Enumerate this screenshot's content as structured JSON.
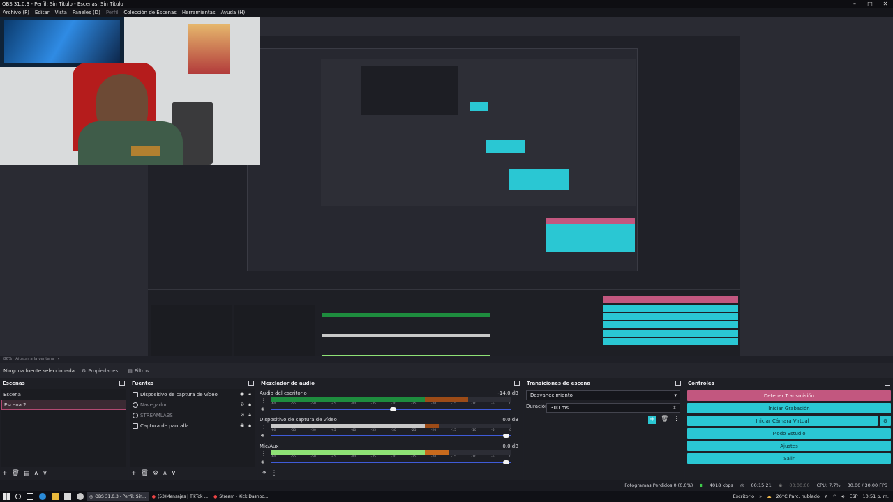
{
  "window": {
    "title": "OBS 31.0.3 - Perfil: Sin Título - Escenas: Sin Título"
  },
  "menu": [
    "Archivo (F)",
    "Editar",
    "Vista",
    "Paneles (D)",
    "Perfil",
    "Colección de Escenas",
    "Herramientas",
    "Ayuda (H)"
  ],
  "scale": {
    "percent": "86%",
    "mode": "Ajustar a la ventana"
  },
  "context_bar": {
    "no_source": "Ninguna fuente seleccionada",
    "properties": "Propiedades",
    "filters": "Filtros"
  },
  "scenes": {
    "title": "Escenas",
    "items": [
      "Escena",
      "Escena 2"
    ],
    "selected": "Escena 2"
  },
  "sources": {
    "title": "Fuentes",
    "items": [
      {
        "name": "Dispositivo de captura de vídeo",
        "visible": true
      },
      {
        "name": "Navegador",
        "visible": false
      },
      {
        "name": "STREAMLABS",
        "visible": false
      },
      {
        "name": "Captura de pantalla",
        "visible": true
      }
    ]
  },
  "mixer": {
    "title": "Mezclador de audio",
    "ticks": [
      "-60",
      "-55",
      "-50",
      "-45",
      "-40",
      "-35",
      "-30",
      "-25",
      "-20",
      "-15",
      "-10",
      "-5",
      "0"
    ],
    "channels": [
      {
        "name": "Audio del escritorio",
        "db": "-14.0 dB",
        "level": 0.82,
        "volume": 0.51,
        "style": "normal"
      },
      {
        "name": "Dispositivo de captura de vídeo",
        "db": "0.0 dB",
        "level": 0.7,
        "volume": 0.98,
        "style": "grey"
      },
      {
        "name": "Mic/Aux",
        "db": "0.0 dB",
        "level": 0.74,
        "volume": 0.98,
        "style": "bright"
      }
    ]
  },
  "transitions": {
    "title": "Transiciones de escena",
    "selected": "Desvanecimiento",
    "duration_label": "Duración",
    "duration": "300 ms"
  },
  "controls": {
    "title": "Controles",
    "buttons": [
      "Detener Transmisión",
      "Iniciar Grabación",
      "Iniciar Cámara Virtual",
      "Modo Estudio",
      "Ajustes",
      "Salir"
    ]
  },
  "status": {
    "dropped": "Fotogramas Perdidos 0 (0.0%)",
    "bitrate": "4018 kbps",
    "stream_time": "00:15:21",
    "rec_time": "00:00:00",
    "cpu": "CPU: 7.7%",
    "fps": "30.00 / 30.00 FPS"
  },
  "taskbar": {
    "tasks": [
      "OBS 31.0.3 - Perfil: Sin...",
      "(53)Mensajes | TikTok ...",
      "Stream - Kick Dashbo..."
    ],
    "desktop": "Escritorio",
    "weather": "26°C  Parc. nublado",
    "lang": "ESP",
    "time": "10:51 p. m."
  },
  "colors": {
    "accent_cyan": "#2ac7d3",
    "stop_pink": "#c2577f",
    "selection": "#b24a72"
  }
}
